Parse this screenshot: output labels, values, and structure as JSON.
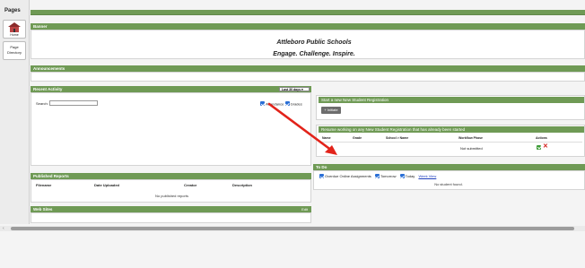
{
  "sidebar": {
    "title": "Pages",
    "home_label": "Home",
    "directory_label": "Page Directory"
  },
  "banner": {
    "header": "Banner",
    "school_name": "Attleboro Public Schools",
    "motto": "Engage. Challenge. Inspire."
  },
  "announcements": {
    "header": "Announcements"
  },
  "recent_activity": {
    "header": "Recent Activity",
    "range_select": "Last 30 days ▾",
    "search_label": "Search:",
    "search_value": "",
    "attendance_label": "Attendance",
    "grades_label": "Grades"
  },
  "published_reports": {
    "header": "Published Reports",
    "columns": [
      "Filename",
      "Date Uploaded",
      "Creator",
      "Description"
    ],
    "empty": "No published reports"
  },
  "web_sites": {
    "header": "Web Sites",
    "edit_label": "Edit"
  },
  "new_registration": {
    "header": "Start a new New Student Registration",
    "add_label": "+ Initiate"
  },
  "resume_registration": {
    "header": "Resume working on any New Student Registration that has already been started",
    "columns": [
      "Name",
      "Grade",
      "School > Name",
      "Workflow Phase",
      "Actions"
    ],
    "rows": [
      {
        "phase": "Not submitted"
      }
    ]
  },
  "todo": {
    "header": "To Do",
    "overdue_label": "Overdue Online Assignments",
    "tomorrow_label": "Tomorrow",
    "today_label": "Today",
    "week_link": "Week View",
    "empty": "No student found."
  },
  "colors": {
    "accent": "#6f9a55",
    "annotation_arrow": "#e2231a"
  }
}
